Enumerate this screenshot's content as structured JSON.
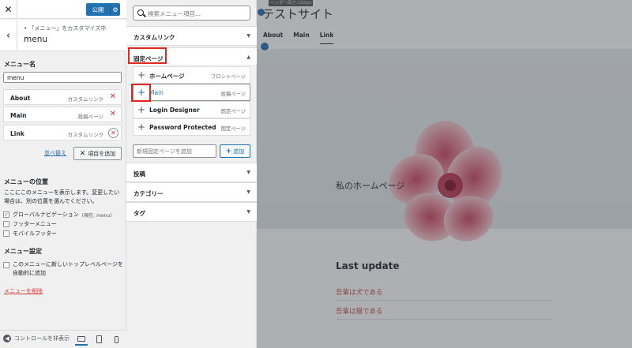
{
  "header": {
    "close_icon": "close-icon",
    "publish_label": "公開",
    "back_icon": "chevron-left-icon",
    "crumb_sub": "「メニュー」をカスタマイズ中",
    "crumb_title": "menu"
  },
  "menu_name": {
    "label": "メニュー名",
    "value": "menu"
  },
  "menu_items": [
    {
      "title": "About",
      "type": "カスタムリンク"
    },
    {
      "title": "Main",
      "type": "投稿ページ"
    },
    {
      "title": "Link",
      "type": "カスタムリンク"
    }
  ],
  "actions": {
    "reorder": "並べ替え",
    "add_items": "項目を追加"
  },
  "location": {
    "label": "メニューの位置",
    "description": "ここにこのメニューを表示します。変更したい場合は、別の位置を選んでください。",
    "options": [
      {
        "label": "グローバルナビゲーション",
        "note": "(現在: menu)",
        "checked": true
      },
      {
        "label": "フッターメニュー",
        "checked": false
      },
      {
        "label": "モバイルフッター",
        "checked": false
      }
    ]
  },
  "settings": {
    "label": "メニュー設定",
    "auto_add": "このメニューに新しいトップレベルページを自動的に追加",
    "delete": "メニューを削除"
  },
  "footer": {
    "hide_controls": "コントロールを非表示"
  },
  "available": {
    "search_placeholder": "検索メニュー項目...",
    "sections": [
      {
        "title": "カスタムリンク"
      },
      {
        "title": "固定ページ"
      },
      {
        "title": "投稿"
      },
      {
        "title": "カテゴリー"
      },
      {
        "title": "タグ"
      }
    ],
    "pages": [
      {
        "title": "ホームページ",
        "type": "フロントページ"
      },
      {
        "title": "Main",
        "type": "投稿ページ"
      },
      {
        "title": "Login Designer",
        "type": "固定ページ"
      },
      {
        "title": "Password Protected",
        "type": "固定ページ"
      }
    ],
    "new_page_placeholder": "新規固定ページを追加",
    "add_button": "追加"
  },
  "preview": {
    "header_tag": "ヘッダー高さ:102px",
    "site_title": "テストサイト",
    "nav": [
      "About",
      "Main",
      "Link"
    ],
    "hero_text": "私のホームページ",
    "last_update": "Last update",
    "posts": [
      "吾輩は犬である",
      "吾輩は猫である"
    ]
  },
  "colors": {
    "accent": "#2271b1",
    "highlight": "#e0271d",
    "danger": "#d63638"
  }
}
